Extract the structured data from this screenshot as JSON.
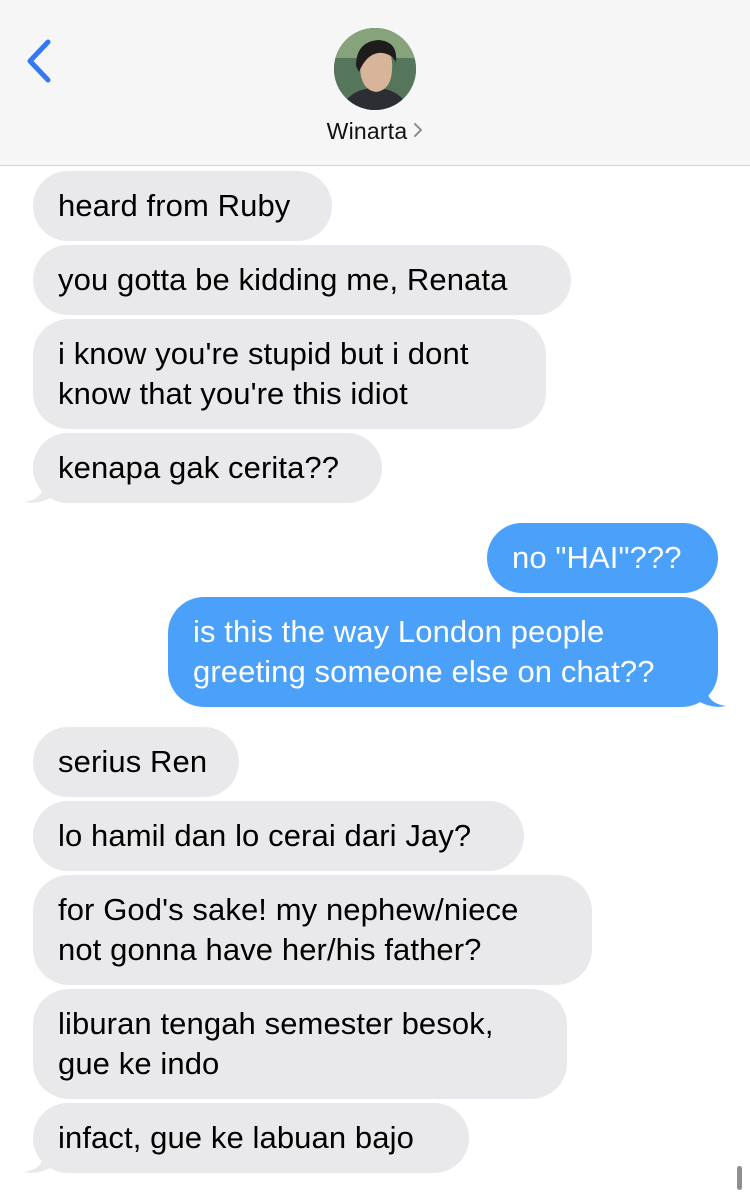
{
  "header": {
    "contact_name": "Winarta",
    "chevron": "chevron-right-icon",
    "back_icon": "chevron-left-icon",
    "accent": "#3478f6"
  },
  "colors": {
    "incoming": "#e9e9eb",
    "outgoing": "#4ba1f9"
  },
  "messages": [
    {
      "dir": "in",
      "text": "heard from Ruby"
    },
    {
      "dir": "in",
      "text": "you gotta be kidding me, Renata"
    },
    {
      "dir": "in",
      "text": "i know you're stupid but i dont\nknow that you're this idiot"
    },
    {
      "dir": "in",
      "text": "kenapa gak cerita??"
    },
    {
      "dir": "out",
      "text": "no \"HAI\"???"
    },
    {
      "dir": "out",
      "text": "is this the way London people\ngreeting someone else on chat??"
    },
    {
      "dir": "in",
      "text": "serius Ren"
    },
    {
      "dir": "in",
      "text": "lo hamil dan lo cerai dari Jay?"
    },
    {
      "dir": "in",
      "text": "for God's sake! my nephew/niece\nnot gonna have her/his father?"
    },
    {
      "dir": "in",
      "text": "liburan tengah semester besok,\ngue ke indo"
    },
    {
      "dir": "in",
      "text": "infact, gue ke labuan bajo"
    }
  ]
}
